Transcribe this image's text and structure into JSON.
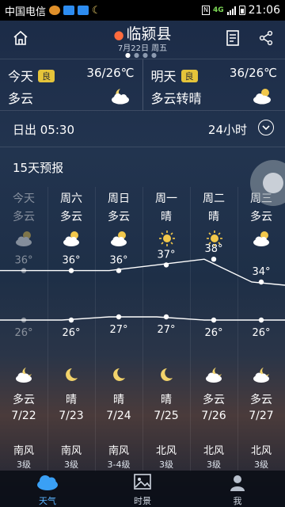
{
  "status_bar": {
    "carrier": "中国电信",
    "network": "4G",
    "time": "21:06"
  },
  "header": {
    "city": "临颍县",
    "date": "7月22日 周五"
  },
  "today": {
    "label": "今天",
    "aqi": "良",
    "temp": "36/26℃",
    "condition": "多云"
  },
  "tomorrow": {
    "label": "明天",
    "aqi": "良",
    "temp": "36/26℃",
    "condition": "多云转晴"
  },
  "sunrise": {
    "text": "日出 05:30",
    "hours_label": "24小时"
  },
  "forecast": {
    "title": "15天预报",
    "days": [
      {
        "weekday": "今天",
        "day_cond": "多云",
        "day_icon": "partly-cloudy-icon",
        "high": "36°",
        "low": "26°",
        "night_cond": "多云",
        "date": "7/22",
        "night_icon": "partly-cloudy-night-icon",
        "wind": "南风",
        "wind_level": "3级"
      },
      {
        "weekday": "周六",
        "day_cond": "多云",
        "day_icon": "partly-cloudy-icon",
        "high": "36°",
        "low": "26°",
        "night_cond": "晴",
        "date": "7/23",
        "night_icon": "moon-icon",
        "wind": "南风",
        "wind_level": "3级"
      },
      {
        "weekday": "周日",
        "day_cond": "多云",
        "day_icon": "partly-cloudy-icon",
        "high": "36°",
        "low": "27°",
        "night_cond": "晴",
        "date": "7/24",
        "night_icon": "moon-icon",
        "wind": "南风",
        "wind_level": "3-4级"
      },
      {
        "weekday": "周一",
        "day_cond": "晴",
        "day_icon": "sun-icon",
        "high": "37°",
        "low": "27°",
        "night_cond": "晴",
        "date": "7/25",
        "night_icon": "moon-icon",
        "wind": "北风",
        "wind_level": "3级"
      },
      {
        "weekday": "周二",
        "day_cond": "晴",
        "day_icon": "sun-icon",
        "high": "38°",
        "low": "26°",
        "night_cond": "多云",
        "date": "7/26",
        "night_icon": "partly-cloudy-night-icon",
        "wind": "北风",
        "wind_level": "3级"
      },
      {
        "weekday": "周三",
        "day_cond": "多云",
        "day_icon": "partly-cloudy-icon",
        "high": "34°",
        "low": "26°",
        "night_cond": "多云",
        "date": "7/27",
        "night_icon": "partly-cloudy-night-icon",
        "wind": "北风",
        "wind_level": "3级"
      }
    ]
  },
  "chart_data": {
    "type": "line",
    "categories": [
      "今天",
      "周六",
      "周日",
      "周一",
      "周二",
      "周三"
    ],
    "series": [
      {
        "values": [
          36,
          36,
          36,
          37,
          38,
          34
        ]
      },
      {
        "values": [
          26,
          26,
          27,
          27,
          26,
          26
        ]
      }
    ]
  },
  "tabs": [
    {
      "label": "天气",
      "icon": "cloud-icon",
      "active": true
    },
    {
      "label": "时景",
      "icon": "picture-icon",
      "active": false
    },
    {
      "label": "我",
      "icon": "person-icon",
      "active": false
    }
  ],
  "colors": {
    "accent": "#5cb4ff",
    "aqi_badge": "#e5c43a",
    "location_pin": "#ff6b3d"
  }
}
